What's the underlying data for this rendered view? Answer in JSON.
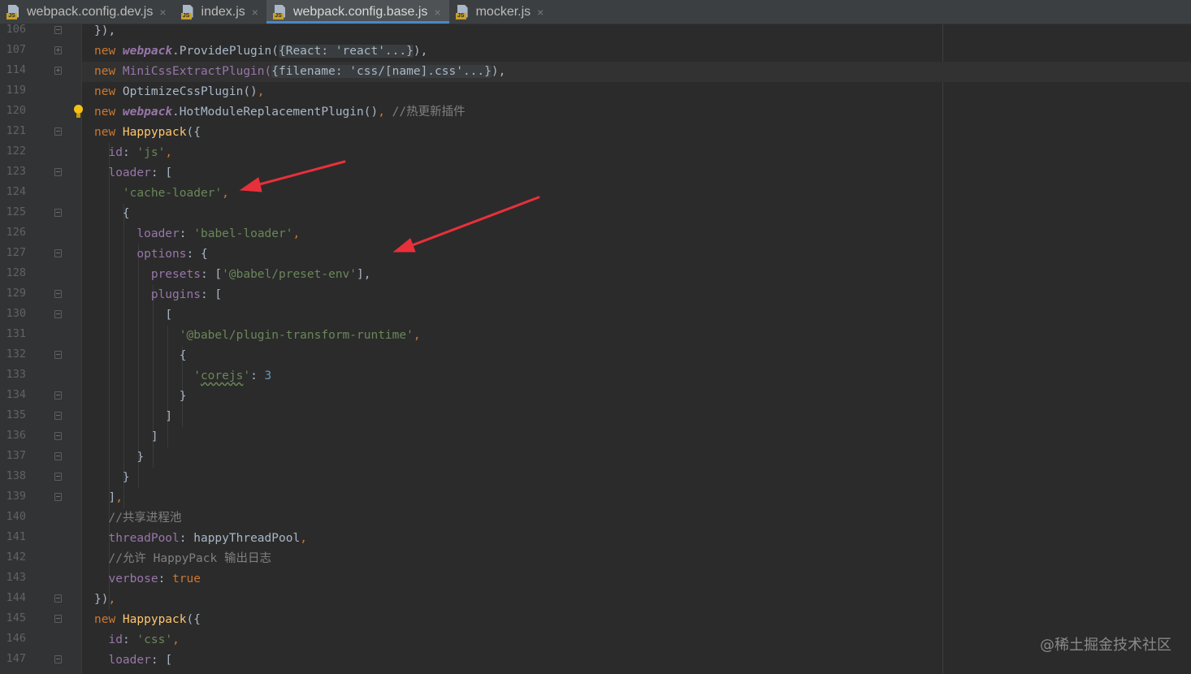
{
  "tabs": [
    {
      "label": "webpack.config.dev.js",
      "active": false,
      "closable": true,
      "icon": "js-file-icon"
    },
    {
      "label": "index.js",
      "active": false,
      "closable": true,
      "icon": "js-file-icon"
    },
    {
      "label": "webpack.config.base.js",
      "active": true,
      "closable": true,
      "icon": "js-file-icon"
    },
    {
      "label": "mocker.js",
      "active": false,
      "closable": true,
      "icon": "js-file-icon"
    }
  ],
  "tab_close_glyph": "×",
  "js_badge": "JS",
  "gutter": {
    "line_numbers": [
      "106",
      "107",
      "114",
      "119",
      "120",
      "121",
      "122",
      "123",
      "124",
      "125",
      "126",
      "127",
      "128",
      "129",
      "130",
      "131",
      "132",
      "133",
      "134",
      "135",
      "136",
      "137",
      "138",
      "139",
      "140",
      "141",
      "142",
      "143",
      "144",
      "145",
      "146",
      "147"
    ]
  },
  "code": {
    "l106": "}),",
    "l107_pre": "new ",
    "l107_obj": "webpack",
    "l107_call": ".ProvidePlugin(",
    "l107_fold": "{React: 'react'...}",
    "l107_end": "),",
    "l114_pre": "new ",
    "l114_name": "MiniCssExtractPlugin(",
    "l114_fold": "{filename: 'css/[name].css'...}",
    "l114_end": "),",
    "l119_pre": "new ",
    "l119_name": "OptimizeCssPlugin()",
    "l119_end": ",",
    "l120_pre": "new ",
    "l120_obj": "webpack",
    "l120_call": ".HotModuleReplacementPlugin()",
    "l120_comma": ",",
    "l120_cmt": " //热更新插件",
    "l121_pre": "new ",
    "l121_name": "Happypack",
    "l121_end": "({",
    "l122_key": "id",
    "l122_colon": ": ",
    "l122_val": "'js'",
    "l122_end": ",",
    "l123_key": "loader",
    "l123_end": ": [",
    "l124_val": "'cache-loader'",
    "l124_end": ",",
    "l125": "{",
    "l126_key": "loader",
    "l126_colon": ": ",
    "l126_val": "'babel-loader'",
    "l126_end": ",",
    "l127_key": "options",
    "l127_end": ": {",
    "l128_key": "presets",
    "l128_mid": ": [",
    "l128_val": "'@babel/preset-env'",
    "l128_end": "],",
    "l129_key": "plugins",
    "l129_end": ": [",
    "l130": "[",
    "l131_val": "'@babel/plugin-transform-runtime'",
    "l131_end": ",",
    "l132": "{",
    "l133_q1": "'",
    "l133_key": "corejs",
    "l133_q2": "'",
    "l133_colon": ": ",
    "l133_val": "3",
    "l134": "}",
    "l135": "]",
    "l136": "]",
    "l137": "}",
    "l138": "}",
    "l139_b": "]",
    "l139_end": ",",
    "l140": "//共享进程池",
    "l141_key": "threadPool",
    "l141_val": ": happyThreadPool",
    "l141_end": ",",
    "l142": "//允许 HappyPack 输出日志",
    "l143_key": "verbose",
    "l143_colon": ": ",
    "l143_val": "true",
    "l144_b": "})",
    "l144_end": ",",
    "l145_pre": "new ",
    "l145_name": "Happypack",
    "l145_end": "({",
    "l146_key": "id",
    "l146_colon": ": ",
    "l146_val": "'css'",
    "l146_end": ",",
    "l147_key": "loader",
    "l147_end": ": ["
  },
  "annotation_color": "#e8303a",
  "watermark": "@稀土掘金技术社区"
}
